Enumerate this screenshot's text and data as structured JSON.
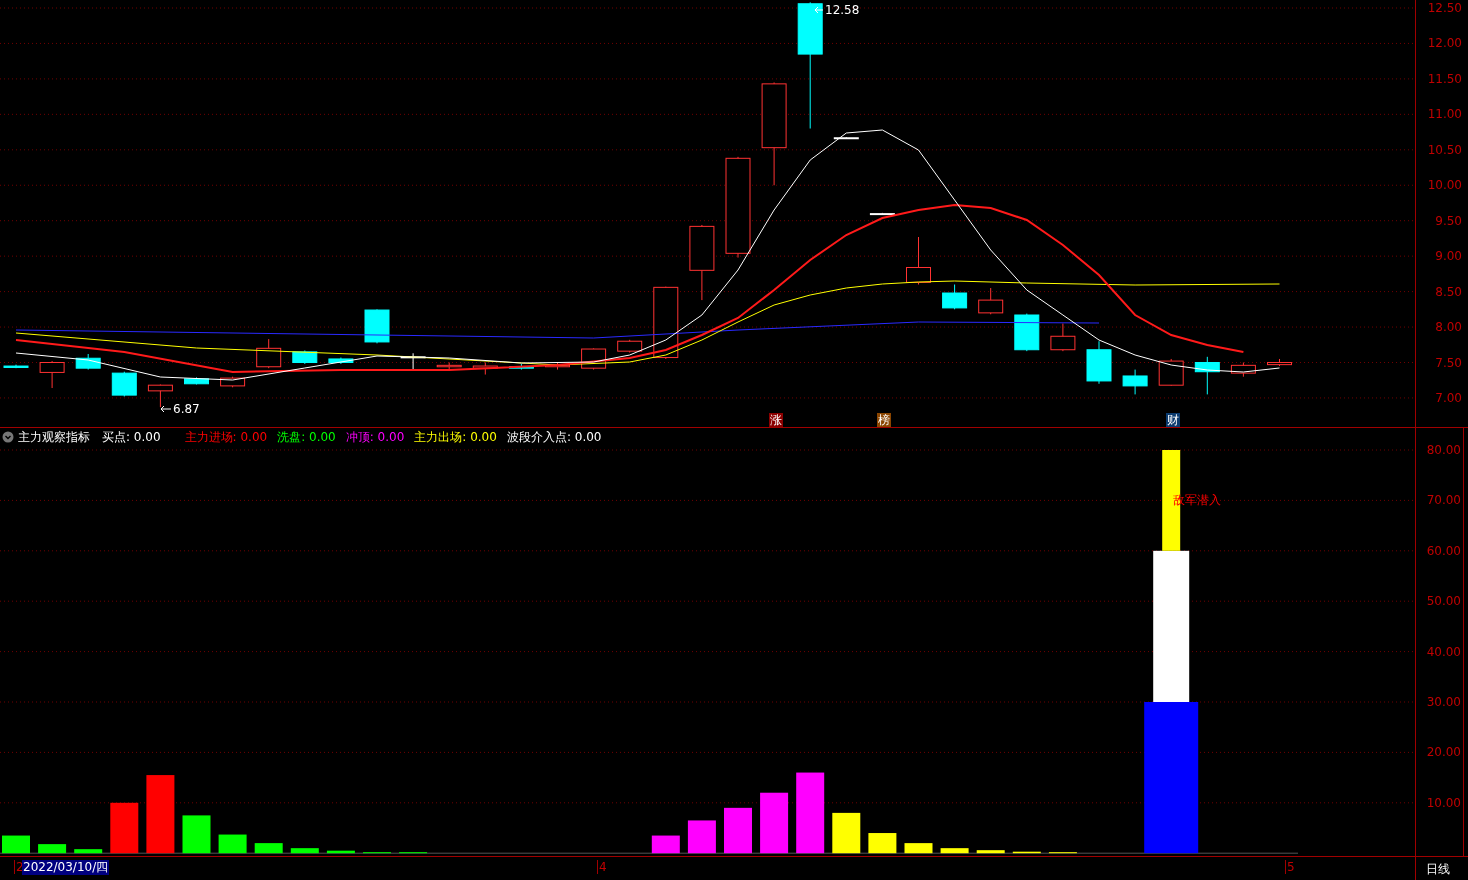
{
  "price_axis": [
    "12.50",
    "12.00",
    "11.50",
    "11.00",
    "10.50",
    "10.00",
    "9.50",
    "9.00",
    "8.50",
    "8.00",
    "7.50",
    "7.00"
  ],
  "price_markers": [
    {
      "kind": "high",
      "text": "12.58"
    },
    {
      "kind": "low",
      "text": "6.87"
    }
  ],
  "event_badges": [
    {
      "text": "涨",
      "color": "#8b0000"
    },
    {
      "text": "榜",
      "color": "#8b4500"
    },
    {
      "text": "财",
      "color": "#0a3a6e"
    }
  ],
  "indicator": {
    "name": "主力观察指标",
    "items": [
      {
        "text": "买点: 0.00",
        "color": "#ffffff"
      },
      {
        "text": "主力进场: 0.00",
        "color": "#ff0000"
      },
      {
        "text": "洗盘: 0.00",
        "color": "#00ff00"
      },
      {
        "text": "冲顶: 0.00",
        "color": "#ff00ff"
      },
      {
        "text": "主力出场: 0.00",
        "color": "#ffff00"
      },
      {
        "text": "波段介入点: 0.00",
        "color": "#ffffff"
      }
    ]
  },
  "indicator_axis": [
    "80.00",
    "70.00",
    "60.00",
    "50.00",
    "40.00",
    "30.00",
    "20.00",
    "10.00"
  ],
  "signal_label": "敌军潜入",
  "month_labels": [
    {
      "text": "2"
    },
    {
      "text": "4"
    },
    {
      "text": "5"
    }
  ],
  "cursor_date": "2022/03/10/四",
  "period": "日线"
}
